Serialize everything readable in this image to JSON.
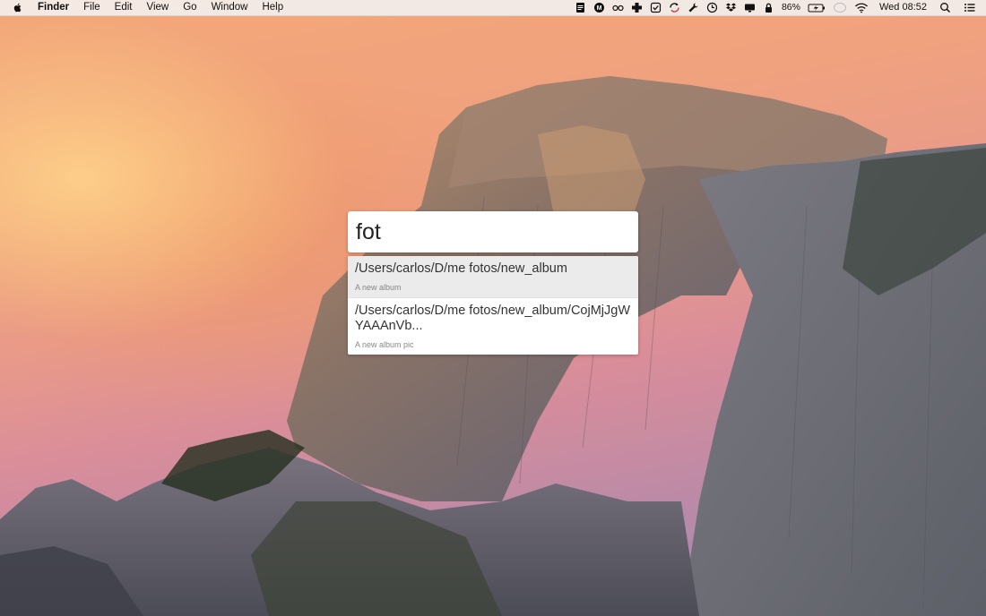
{
  "menubar": {
    "apple_icon": "apple-icon",
    "app_name": "Finder",
    "menus": [
      "File",
      "Edit",
      "View",
      "Go",
      "Window",
      "Help"
    ],
    "battery_percent": "86%",
    "clock": "Wed 08:52",
    "tray_icons": [
      "notes-icon",
      "record-icon",
      "glasses-icon",
      "first-aid-icon",
      "checkbox-icon",
      "sync-icon",
      "wrench-icon",
      "clock-icon",
      "dropbox-icon",
      "display-icon",
      "lock-icon",
      "battery-icon",
      "chat-bubble-icon",
      "wifi-icon",
      "spotlight-search-icon",
      "notification-center-icon"
    ]
  },
  "launcher": {
    "query": "fot",
    "results": [
      {
        "title": "/Users/carlos/D/me fotos/new_album",
        "subtitle": "A new album",
        "selected": true
      },
      {
        "title": "/Users/carlos/D/me fotos/new_album/CojMjJgWYAAAnVb...",
        "subtitle": "A new album pic",
        "selected": false
      }
    ]
  },
  "colors": {
    "menubar_bg": "#f3eeec",
    "selected_row": "#ebebeb",
    "sky_top": "#f3a878",
    "sky_right": "#9d86b2"
  }
}
